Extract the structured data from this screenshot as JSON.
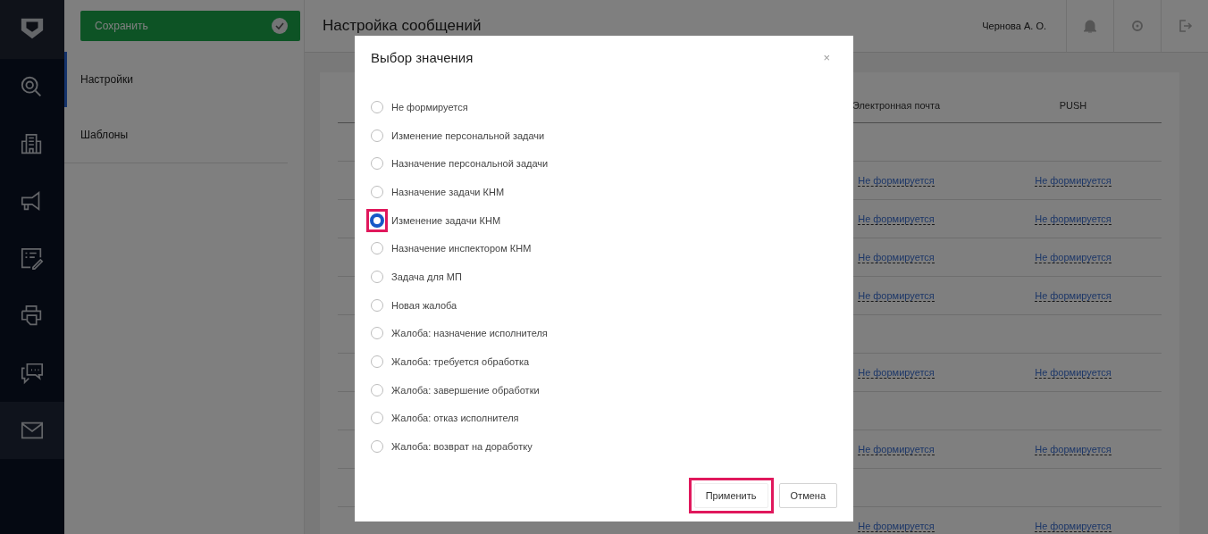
{
  "sidebar": {
    "items": [
      {
        "kind": "logo",
        "selected": false
      },
      {
        "kind": "search",
        "selected": false
      },
      {
        "kind": "building",
        "selected": false
      },
      {
        "kind": "megaphone",
        "selected": false
      },
      {
        "kind": "edit",
        "selected": false
      },
      {
        "kind": "printer",
        "selected": false
      },
      {
        "kind": "chat",
        "selected": false
      },
      {
        "kind": "mail",
        "selected": true
      }
    ]
  },
  "save_button": {
    "label": "Сохранить"
  },
  "left_nav": [
    {
      "label": "Настройки",
      "selected": true
    },
    {
      "label": "Шаблоны",
      "selected": false
    }
  ],
  "header": {
    "title": "Настройка сообщений",
    "user": "Чернова А. О."
  },
  "table": {
    "columns": [
      "Электронная почта",
      "PUSH"
    ],
    "rows": [
      {
        "kind": "blank"
      },
      {
        "kind": "values",
        "email": "Не формируется",
        "push": "Не формируется"
      },
      {
        "kind": "values",
        "email": "Не формируется",
        "push": "Не формируется"
      },
      {
        "kind": "values",
        "email": "Не формируется",
        "push": "Не формируется"
      },
      {
        "kind": "values",
        "email": "Не формируется",
        "push": "Не формируется"
      },
      {
        "kind": "blank"
      },
      {
        "kind": "values",
        "email": "Не формируется",
        "push": "Не формируется"
      },
      {
        "kind": "blank"
      },
      {
        "kind": "values",
        "email": "Не формируется",
        "push": "Не формируется"
      },
      {
        "kind": "blank"
      },
      {
        "kind": "values",
        "email": "Не формируется",
        "push": "Не формируется"
      }
    ]
  },
  "dialog": {
    "title": "Выбор значения",
    "close": "×",
    "options": [
      {
        "label": "Не формируется",
        "selected": false,
        "highlighted": false
      },
      {
        "label": "Изменение персональной задачи",
        "selected": false,
        "highlighted": false
      },
      {
        "label": "Назначение персональной задачи",
        "selected": false,
        "highlighted": false
      },
      {
        "label": "Назначение задачи КНМ",
        "selected": false,
        "highlighted": false
      },
      {
        "label": "Изменение задачи КНМ",
        "selected": true,
        "highlighted": true
      },
      {
        "label": "Назначение инспектором КНМ",
        "selected": false,
        "highlighted": false
      },
      {
        "label": "Задача для МП",
        "selected": false,
        "highlighted": false
      },
      {
        "label": "Новая жалоба",
        "selected": false,
        "highlighted": false
      },
      {
        "label": "Жалоба: назначение исполнителя",
        "selected": false,
        "highlighted": false
      },
      {
        "label": "Жалоба: требуется обработка",
        "selected": false,
        "highlighted": false
      },
      {
        "label": "Жалоба: завершение обработки",
        "selected": false,
        "highlighted": false
      },
      {
        "label": "Жалоба: отказ исполнителя",
        "selected": false,
        "highlighted": false
      },
      {
        "label": "Жалоба: возврат на доработку",
        "selected": false,
        "highlighted": false
      }
    ],
    "buttons": [
      {
        "label": "Применить",
        "kind": "primary",
        "highlighted": true
      },
      {
        "label": "Отмена",
        "kind": "secondary",
        "highlighted": false
      }
    ]
  }
}
